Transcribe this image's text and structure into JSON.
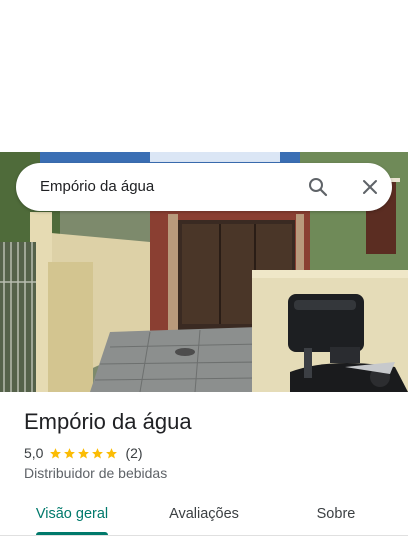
{
  "search": {
    "query": "Empório da água",
    "search_icon": "search-icon",
    "close_icon": "close-icon"
  },
  "place": {
    "name": "Empório da água",
    "rating": "5,0",
    "star_count": 5,
    "review_count": "(2)",
    "category": "Distribuidor de bebidas"
  },
  "tabs": [
    {
      "label": "Visão geral",
      "active": true
    },
    {
      "label": "Avaliações",
      "active": false
    },
    {
      "label": "Sobre",
      "active": false
    }
  ],
  "colors": {
    "accent": "#00796b",
    "star": "#fbbc04"
  }
}
